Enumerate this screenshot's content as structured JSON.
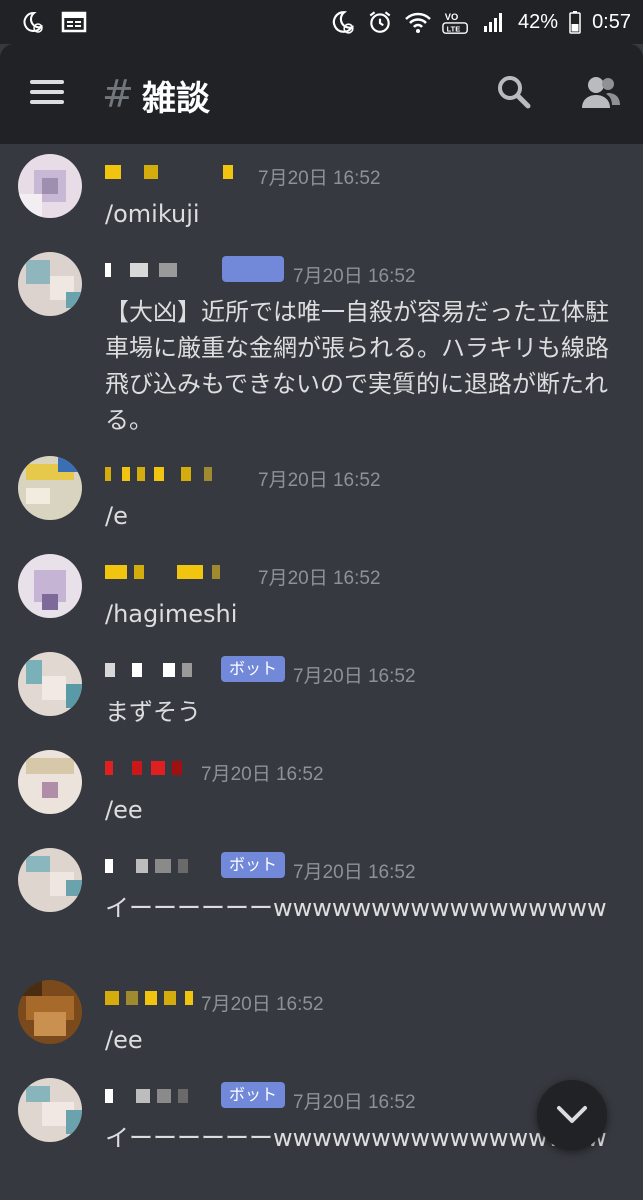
{
  "status_bar": {
    "battery": "42%",
    "time": "0:57",
    "icons_left": [
      "moon-alarm-icon",
      "calendar-icon"
    ],
    "icons_right": [
      "moon-alarm-icon",
      "alarm-icon",
      "wifi-icon",
      "volte-icon",
      "signal-icon",
      "battery-icon"
    ]
  },
  "header": {
    "channel_hash": "#",
    "channel_name": "雑談",
    "icons": [
      "menu-icon",
      "search-icon",
      "members-icon"
    ]
  },
  "colors": {
    "background": "#36393f",
    "header": "#202225",
    "bot_badge": "#7289da",
    "timestamp": "#8e9297",
    "text": "#dcddde"
  },
  "messages": [
    {
      "username_color": "#f1c40f",
      "bot": false,
      "timestamp": "7月20日 16:52",
      "text": "/omikuji"
    },
    {
      "username_color": "#ffffff",
      "bot": false,
      "timestamp": "7月20日 16:52",
      "text": "【大凶】近所では唯一自殺が容易だった立体駐車場に厳重な金網が張られる。ハラキリも線路飛び込みもできないので実質的に退路が断たれる。"
    },
    {
      "username_color": "#f1c40f",
      "bot": false,
      "timestamp": "7月20日 16:52",
      "text": "/e"
    },
    {
      "username_color": "#f1c40f",
      "bot": false,
      "timestamp": "7月20日 16:52",
      "text": "/hagimeshi"
    },
    {
      "username_color": "#ffffff",
      "bot": true,
      "badge": "ボット",
      "timestamp": "7月20日 16:52",
      "text": "まずそう"
    },
    {
      "username_color": "#e02020",
      "bot": false,
      "timestamp": "7月20日 16:52",
      "text": "/ee"
    },
    {
      "username_color": "#ffffff",
      "bot": true,
      "badge": "ボット",
      "timestamp": "7月20日 16:52",
      "text": "イーーーーーーwwwwwwwwwwwwwwwww"
    },
    {
      "username_color": "#f1c40f",
      "bot": false,
      "timestamp": "7月20日 16:52",
      "text": "/ee"
    },
    {
      "username_color": "#ffffff",
      "bot": true,
      "badge": "ボット",
      "timestamp": "7月20日 16:52",
      "text": "イーーーーーーwwwwwwwwwwwwwwwww"
    }
  ],
  "scroll_button": {
    "icon": "chevron-down-icon"
  }
}
